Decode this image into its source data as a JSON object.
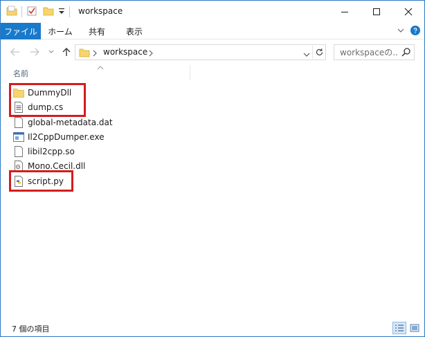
{
  "window": {
    "title": "workspace"
  },
  "ribbon": {
    "tabs": [
      "ファイル",
      "ホーム",
      "共有",
      "表示"
    ]
  },
  "address": {
    "path": "workspace"
  },
  "search": {
    "placeholder": "workspaceの..."
  },
  "columns": {
    "name": "名前"
  },
  "files": [
    {
      "name": "DummyDll",
      "type": "folder",
      "highlighted": true
    },
    {
      "name": "dump.cs",
      "type": "text",
      "highlighted": true
    },
    {
      "name": "global-metadata.dat",
      "type": "blank",
      "highlighted": false
    },
    {
      "name": "Il2CppDumper.exe",
      "type": "exe",
      "highlighted": false
    },
    {
      "name": "libil2cpp.so",
      "type": "blank",
      "highlighted": false
    },
    {
      "name": "Mono.Cecil.dll",
      "type": "dll",
      "highlighted": false
    },
    {
      "name": "script.py",
      "type": "python",
      "highlighted": true
    }
  ],
  "status": {
    "item_count": "7 個の項目"
  },
  "colors": {
    "accent": "#1979ca",
    "highlight": "#d21d1d",
    "folder": "#f7d56e"
  }
}
